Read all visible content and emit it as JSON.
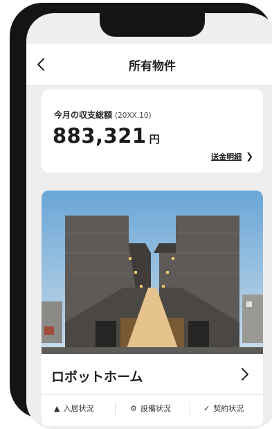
{
  "header": {
    "title": "所有物件"
  },
  "balance": {
    "label": "今月の収支総額",
    "period": "(20XX.10)",
    "amount": "883,321",
    "unit": "円",
    "link_label": "送金明細"
  },
  "property": {
    "name": "ロボットホーム",
    "stats": [
      {
        "icon": "house-icon",
        "label": "入居状況"
      },
      {
        "icon": "gear-icon",
        "label": "設備状況"
      },
      {
        "icon": "check-icon",
        "label": "契約状況"
      }
    ]
  },
  "colors": {
    "background": "#eeeeee",
    "card": "#ffffff",
    "phone_frame": "#141414",
    "text": "#222222"
  }
}
